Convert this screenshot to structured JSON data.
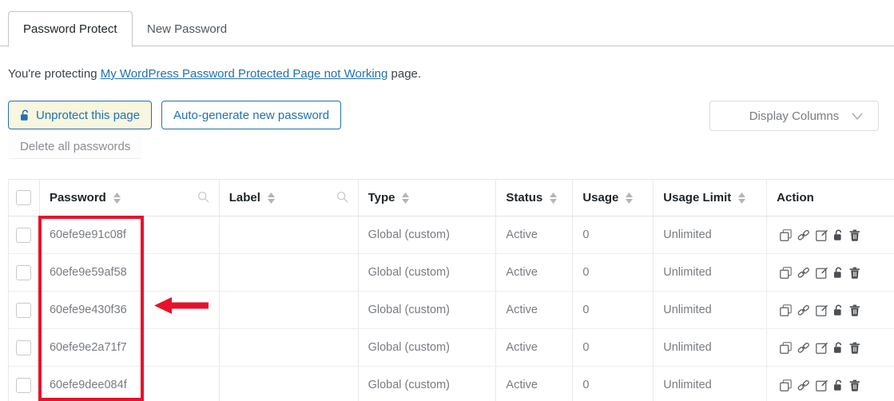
{
  "tabs": [
    {
      "label": "Password Protect",
      "active": true
    },
    {
      "label": "New Password",
      "active": false
    }
  ],
  "description": {
    "prefix": "You're protecting ",
    "link": "My WordPress Password Protected Page not Working",
    "suffix": " page."
  },
  "toolbar": {
    "unprotect_label": "Unprotect this page",
    "unprotect_icon": "open-lock-icon",
    "generate_label": "Auto-generate new password",
    "delete_all_label": "Delete all passwords",
    "display_columns_label": "Display Columns",
    "display_columns_icon": "chevron-down-icon"
  },
  "table": {
    "columns": [
      {
        "key": "check",
        "label": "",
        "sortable": false,
        "searchable": false
      },
      {
        "key": "pass",
        "label": "Password",
        "sortable": true,
        "searchable": true
      },
      {
        "key": "label",
        "label": "Label",
        "sortable": true,
        "searchable": true
      },
      {
        "key": "type",
        "label": "Type",
        "sortable": true,
        "searchable": false
      },
      {
        "key": "status",
        "label": "Status",
        "sortable": true,
        "searchable": false
      },
      {
        "key": "usage",
        "label": "Usage",
        "sortable": true,
        "searchable": false
      },
      {
        "key": "limit",
        "label": "Usage Limit",
        "sortable": true,
        "searchable": false
      },
      {
        "key": "action",
        "label": "Action",
        "sortable": false,
        "searchable": false
      }
    ],
    "rows": [
      {
        "password": "60efe9e91c08f",
        "label": "",
        "type": "Global (custom)",
        "status": "Active",
        "usage": "0",
        "limit": "Unlimited"
      },
      {
        "password": "60efe9e59af58",
        "label": "",
        "type": "Global (custom)",
        "status": "Active",
        "usage": "0",
        "limit": "Unlimited"
      },
      {
        "password": "60efe9e430f36",
        "label": "",
        "type": "Global (custom)",
        "status": "Active",
        "usage": "0",
        "limit": "Unlimited"
      },
      {
        "password": "60efe9e2a71f7",
        "label": "",
        "type": "Global (custom)",
        "status": "Active",
        "usage": "0",
        "limit": "Unlimited"
      },
      {
        "password": "60efe9dee084f",
        "label": "",
        "type": "Global (custom)",
        "status": "Active",
        "usage": "0",
        "limit": "Unlimited"
      }
    ],
    "row_action_icons": [
      "copy-icon",
      "link-icon",
      "edit-icon",
      "unlock-icon",
      "trash-icon"
    ]
  },
  "annotations": {
    "highlight_rect_target": "password-column-values",
    "arrow_target": "password-column-values",
    "color": "#e8112d"
  },
  "colors": {
    "accent_blue": "#2271b1",
    "status_green": "#3cb43c",
    "annotation_red": "#e8112d",
    "muted_text": "#787c82"
  }
}
